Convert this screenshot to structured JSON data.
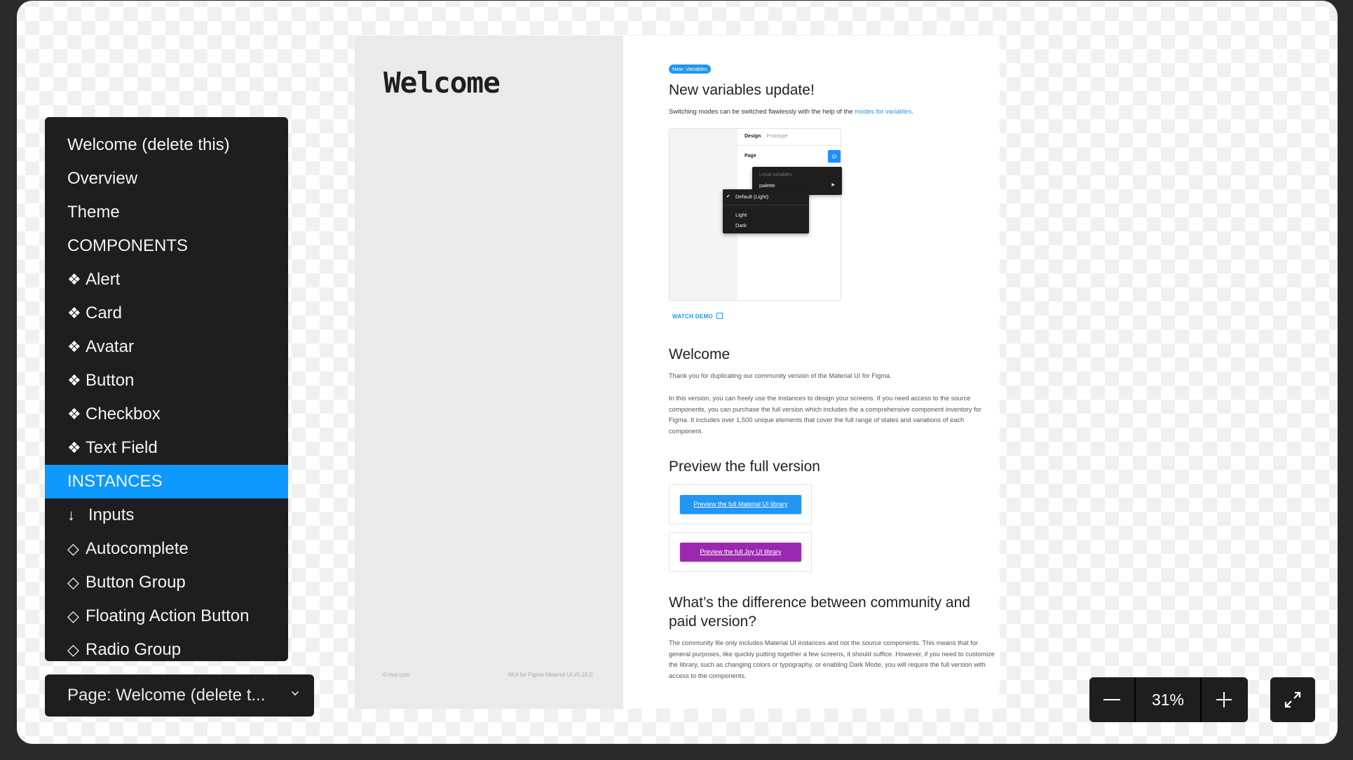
{
  "frame": {
    "title": "Welcome",
    "footer_left": "© mui.com",
    "footer_right": "MUI for Figma Material UI v5.16.0"
  },
  "variables_section": {
    "badge": "New: Variables",
    "heading": "New variables update!",
    "text_before_link": "Switching modes can be switched flawlessly with the help of the ",
    "link_text": "modes for variables",
    "text_after_link": ".",
    "mockup": {
      "tab_design": "Design",
      "tab_prototype": "Prototype",
      "page_label": "Page",
      "menu_header": "Local variables",
      "menu_item": "palette",
      "mode_selected": "Default (Light)",
      "mode_light": "Light",
      "mode_dark": "Dark"
    },
    "watch_demo": "WATCH DEMO"
  },
  "welcome_section": {
    "heading": "Welcome",
    "para1": "Thank you for duplicating our community version of the Material UI for Figma.",
    "para2": "In this version, you can freely use the instances to design your screens. If you need access to the source components, you can purchase the full version which includes the a comprehensive component inventory for Figma. It includes over 1,500 unique elements that cover the full range of states and variations of each component."
  },
  "preview_section": {
    "heading": "Preview the full version",
    "material_button": "Preview the full Material UI library",
    "joy_button": "Preview the full Joy UI library",
    "colors": {
      "material": "#2196f3",
      "joy": "#9c27b0"
    }
  },
  "difference_section": {
    "heading": "What’s the difference between community and paid version?",
    "body": "The community file only includes Material UI instances and not the source components. This means that for general purposes, like quickly putting together a few screens, it should suffice. However, if you need to customize the library, such as changing colors or typography, or enabling Dark Mode, you will require the full version with access to the components."
  },
  "page_list": {
    "items": [
      {
        "label": "Welcome (delete this)",
        "icon": "",
        "active": false
      },
      {
        "label": "Overview",
        "icon": "",
        "active": false
      },
      {
        "label": "Theme",
        "icon": "",
        "active": false
      },
      {
        "label": "COMPONENTS",
        "icon": "",
        "active": false
      },
      {
        "label": "Alert",
        "icon": "❖",
        "active": false
      },
      {
        "label": "Card",
        "icon": "❖",
        "active": false
      },
      {
        "label": "Avatar",
        "icon": "❖",
        "active": false
      },
      {
        "label": "Button",
        "icon": "❖",
        "active": false
      },
      {
        "label": "Checkbox",
        "icon": "❖",
        "active": false
      },
      {
        "label": "Text Field",
        "icon": "❖",
        "active": false
      },
      {
        "label": "INSTANCES",
        "icon": "",
        "active": true
      },
      {
        "label": "Inputs",
        "icon": "↓",
        "active": false
      },
      {
        "label": "Autocomplete",
        "icon": "◇",
        "active": false
      },
      {
        "label": "Button Group",
        "icon": "◇",
        "active": false
      },
      {
        "label": "Floating Action Button",
        "icon": "◇",
        "active": false
      },
      {
        "label": "Radio Group",
        "icon": "◇",
        "active": false
      }
    ],
    "active_color": "#0d99ff"
  },
  "page_select": {
    "label": "Page: Welcome (delete t..."
  },
  "zoom_controls": {
    "value": "31%",
    "zoom_out_icon": "minus-icon",
    "zoom_in_icon": "plus-icon",
    "fullscreen_icon": "expand-icon"
  }
}
